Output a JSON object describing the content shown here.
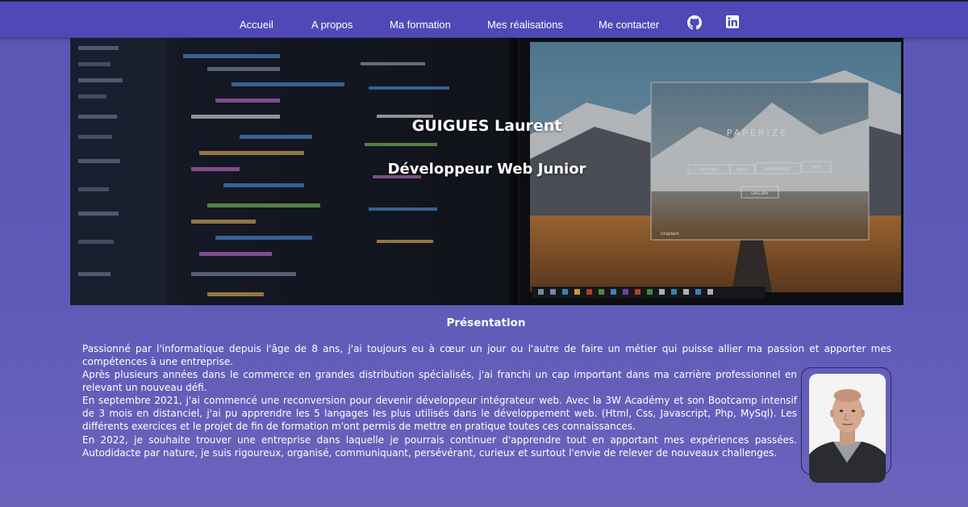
{
  "nav": {
    "items": [
      "Accueil",
      "A propos",
      "Ma formation",
      "Mes réalisations",
      "Me contacter"
    ],
    "icons": [
      "github-icon",
      "linkedin-icon"
    ]
  },
  "hero": {
    "name": "GUIGUES Laurent",
    "subtitle": "Développeur Web Junior",
    "screen_app": "PAPERIZE",
    "screen_buttons": [
      "SETTINGS",
      "NEXT",
      "RANDOMIZE",
      "HIDE"
    ],
    "screen_gallery": "GALLERY",
    "screen_credit": "Unsplash"
  },
  "presentation": {
    "title": "Présentation",
    "paragraphs": [
      "Passionné par l'informatique depuis l'âge de 8 ans, j'ai toujours eu à cœur un jour ou l'autre de faire un métier qui puisse allier ma passion et apporter mes compétences à une entreprise.",
      "Après plusieurs années dans le commerce en grandes distribution spécialisés, j'ai franchi un cap important dans ma carrière professionnel en relevant un nouveau défi.",
      "En septembre 2021, j'ai commencé une reconversion pour devenir développeur intégrateur web. Avec la 3W Académy et son Bootcamp intensif de 3 mois en distanciel, j'ai pu apprendre les 5 langages les plus utilisés dans le développement web. (Html, Css, Javascript, Php, MySql). Les différents exercices et le projet de fin de formation m'ont permis de mettre en pratique toutes ces connaissances.",
      "En 2022, je souhaite trouver une entreprise dans laquelle je pourrais continuer d'apprendre tout en apportant mes expériences passées. Autodidacte par nature, je suis rigoureux, organisé, communiquant, persévérant, curieux et surtout l'envie de relever de nouveaux challenges."
    ]
  },
  "colors": {
    "navbar": "#4f49b7",
    "background": "#5a57b3",
    "text": "#ffffff"
  }
}
